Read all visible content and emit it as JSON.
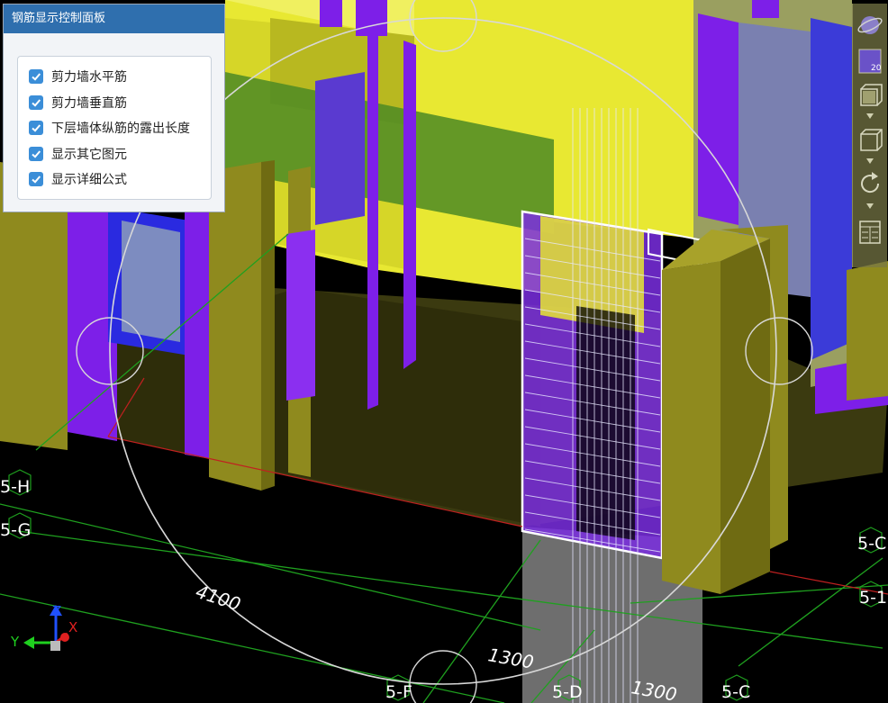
{
  "panel": {
    "title": "钢筋显示控制面板",
    "options": [
      {
        "label": "剪力墙水平筋",
        "checked": true
      },
      {
        "label": "剪力墙垂直筋",
        "checked": true
      },
      {
        "label": "下层墙体纵筋的露出长度",
        "checked": true
      },
      {
        "label": "显示其它图元",
        "checked": true
      },
      {
        "label": "显示详细公式",
        "checked": true
      }
    ]
  },
  "toolbar": {
    "icons": [
      "orbit-icon",
      "view-20-icon",
      "box-front-icon",
      "box-iso-icon",
      "rotate-icon",
      "layout-grid-icon"
    ],
    "view_badge": "20"
  },
  "viewport": {
    "dimensions": [
      "4100",
      "1300",
      "1300"
    ],
    "grid_labels": [
      "5-H",
      "5-G",
      "5-F",
      "5-D",
      "5-C",
      "5-C",
      "5-1"
    ],
    "axis": {
      "x": "X",
      "y": "Y",
      "z": "Z"
    }
  },
  "colors": {
    "wall_yellow": "#e8e832",
    "wall_olive": "#8f8a1e",
    "wall_purple": "#7d1fe8",
    "beam_green": "#3d7a19",
    "panel_header": "#2f6fae",
    "checkbox": "#3b8ed8"
  }
}
